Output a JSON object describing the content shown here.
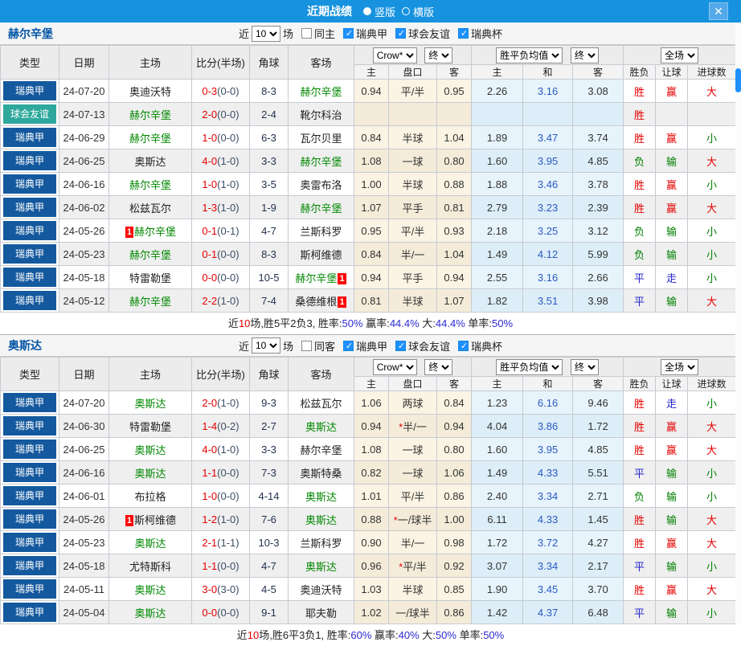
{
  "titlebar": {
    "title": "近期战绩",
    "vertical": "竖版",
    "horizontal": "横版",
    "close": "✕"
  },
  "badge_label": "1",
  "colors": {
    "accent_blue": "#1792DF",
    "league_blue": "#14599E",
    "friendly_teal": "#2EA89C",
    "win_red": "#E60000",
    "lose_green": "#008000",
    "draw_blue": "#2525CC",
    "self_team_green": "#008800",
    "score_red": "#E60000",
    "checkbox_blue": "#1E90FF"
  },
  "header": {
    "type": "类型",
    "date": "日期",
    "home": "主场",
    "score": "比分(半场)",
    "corner": "角球",
    "away": "客场",
    "h_home": "主",
    "h_pan": "盘口",
    "h_away": "客",
    "a_home": "主",
    "a_draw": "和",
    "a_away": "客",
    "wl": "胜负",
    "rq": "让球",
    "goals": "进球数",
    "crow": "Crow*",
    "end": "终",
    "avg": "胜平负均值",
    "full": "全场"
  },
  "tables": [
    {
      "team": "赫尔辛堡",
      "filter": {
        "near": "近",
        "count": "10",
        "games": "场",
        "same": "同主",
        "l1": "瑞典甲",
        "l2": "球会友谊",
        "l3": "瑞典杯"
      },
      "rows": [
        {
          "lg": "瑞典甲",
          "lt": "sw",
          "date": "24-07-20",
          "h": [
            "奥迪沃特",
            0,
            ""
          ],
          "s": "0-3",
          "hf": "(0-0)",
          "c": "8-3",
          "a": [
            "赫尔辛堡",
            1,
            ""
          ],
          "o": [
            "0.94",
            "平/半",
            "0.95"
          ],
          "star": 0,
          "avg": [
            "2.26",
            "3.16",
            "3.08"
          ],
          "r": [
            [
              "胜",
              "r"
            ],
            [
              "赢",
              "r"
            ],
            [
              "大",
              "r"
            ]
          ]
        },
        {
          "lg": "球会友谊",
          "lt": "fr",
          "date": "24-07-13",
          "h": [
            "赫尔辛堡",
            1,
            ""
          ],
          "s": "2-0",
          "hf": "(0-0)",
          "c": "2-4",
          "a": [
            "靴尔科治",
            0,
            ""
          ],
          "o": [
            "",
            "",
            ""
          ],
          "star": 0,
          "avg": [
            "",
            "",
            ""
          ],
          "r": [
            [
              "胜",
              "r"
            ],
            [
              "",
              ""
            ],
            [
              "",
              ""
            ]
          ]
        },
        {
          "lg": "瑞典甲",
          "lt": "sw",
          "date": "24-06-29",
          "h": [
            "赫尔辛堡",
            1,
            ""
          ],
          "s": "1-0",
          "hf": "(0-0)",
          "c": "6-3",
          "a": [
            "瓦尔贝里",
            0,
            ""
          ],
          "o": [
            "0.84",
            "半球",
            "1.04"
          ],
          "star": 0,
          "avg": [
            "1.89",
            "3.47",
            "3.74"
          ],
          "r": [
            [
              "胜",
              "r"
            ],
            [
              "赢",
              "r"
            ],
            [
              "小",
              "g"
            ]
          ]
        },
        {
          "lg": "瑞典甲",
          "lt": "sw",
          "date": "24-06-25",
          "h": [
            "奥斯达",
            0,
            ""
          ],
          "s": "4-0",
          "hf": "(1-0)",
          "c": "3-3",
          "a": [
            "赫尔辛堡",
            1,
            ""
          ],
          "o": [
            "1.08",
            "一球",
            "0.80"
          ],
          "star": 0,
          "avg": [
            "1.60",
            "3.95",
            "4.85"
          ],
          "r": [
            [
              "负",
              "g"
            ],
            [
              "输",
              "g"
            ],
            [
              "大",
              "r"
            ]
          ]
        },
        {
          "lg": "瑞典甲",
          "lt": "sw",
          "date": "24-06-16",
          "h": [
            "赫尔辛堡",
            1,
            ""
          ],
          "s": "1-0",
          "hf": "(1-0)",
          "c": "3-5",
          "a": [
            "奥雷布洛",
            0,
            ""
          ],
          "o": [
            "1.00",
            "半球",
            "0.88"
          ],
          "star": 0,
          "avg": [
            "1.88",
            "3.46",
            "3.78"
          ],
          "r": [
            [
              "胜",
              "r"
            ],
            [
              "赢",
              "r"
            ],
            [
              "小",
              "g"
            ]
          ]
        },
        {
          "lg": "瑞典甲",
          "lt": "sw",
          "date": "24-06-02",
          "h": [
            "松兹瓦尔",
            0,
            ""
          ],
          "s": "1-3",
          "hf": "(1-0)",
          "c": "1-9",
          "a": [
            "赫尔辛堡",
            1,
            ""
          ],
          "o": [
            "1.07",
            "平手",
            "0.81"
          ],
          "star": 0,
          "avg": [
            "2.79",
            "3.23",
            "2.39"
          ],
          "r": [
            [
              "胜",
              "r"
            ],
            [
              "赢",
              "r"
            ],
            [
              "大",
              "r"
            ]
          ]
        },
        {
          "lg": "瑞典甲",
          "lt": "sw",
          "date": "24-05-26",
          "h": [
            "赫尔辛堡",
            1,
            "pre"
          ],
          "s": "0-1",
          "hf": "(0-1)",
          "c": "4-7",
          "a": [
            "兰斯科罗",
            0,
            ""
          ],
          "o": [
            "0.95",
            "平/半",
            "0.93"
          ],
          "star": 0,
          "avg": [
            "2.18",
            "3.25",
            "3.12"
          ],
          "r": [
            [
              "负",
              "g"
            ],
            [
              "输",
              "g"
            ],
            [
              "小",
              "g"
            ]
          ]
        },
        {
          "lg": "瑞典甲",
          "lt": "sw",
          "date": "24-05-23",
          "h": [
            "赫尔辛堡",
            1,
            ""
          ],
          "s": "0-1",
          "hf": "(0-0)",
          "c": "8-3",
          "a": [
            "斯柯维德",
            0,
            ""
          ],
          "o": [
            "0.84",
            "半/一",
            "1.04"
          ],
          "star": 0,
          "avg": [
            "1.49",
            "4.12",
            "5.99"
          ],
          "r": [
            [
              "负",
              "g"
            ],
            [
              "输",
              "g"
            ],
            [
              "小",
              "g"
            ]
          ]
        },
        {
          "lg": "瑞典甲",
          "lt": "sw",
          "date": "24-05-18",
          "h": [
            "特雷勒堡",
            0,
            ""
          ],
          "s": "0-0",
          "hf": "(0-0)",
          "c": "10-5",
          "a": [
            "赫尔辛堡",
            1,
            "post"
          ],
          "o": [
            "0.94",
            "平手",
            "0.94"
          ],
          "star": 0,
          "avg": [
            "2.55",
            "3.16",
            "2.66"
          ],
          "r": [
            [
              "平",
              "b"
            ],
            [
              "走",
              "b"
            ],
            [
              "小",
              "g"
            ]
          ]
        },
        {
          "lg": "瑞典甲",
          "lt": "sw",
          "date": "24-05-12",
          "h": [
            "赫尔辛堡",
            1,
            ""
          ],
          "s": "2-2",
          "hf": "(1-0)",
          "c": "7-4",
          "a": [
            "桑德维根",
            0,
            "post"
          ],
          "o": [
            "0.81",
            "半球",
            "1.07"
          ],
          "star": 0,
          "avg": [
            "1.82",
            "3.51",
            "3.98"
          ],
          "r": [
            [
              "平",
              "b"
            ],
            [
              "输",
              "g"
            ],
            [
              "大",
              "r"
            ]
          ]
        }
      ],
      "summary": [
        [
          "近",
          "k"
        ],
        [
          "10",
          "r"
        ],
        [
          "场,胜5平2负3, 胜率:",
          "k"
        ],
        [
          "50%",
          "p"
        ],
        [
          " 赢率:",
          "k"
        ],
        [
          "44.4%",
          "p"
        ],
        [
          " 大:",
          "k"
        ],
        [
          "44.4%",
          "p"
        ],
        [
          " 单率:",
          "k"
        ],
        [
          "50%",
          "p"
        ]
      ]
    },
    {
      "team": "奥斯达",
      "filter": {
        "near": "近",
        "count": "10",
        "games": "场",
        "same": "同客",
        "l1": "瑞典甲",
        "l2": "球会友谊",
        "l3": "瑞典杯"
      },
      "rows": [
        {
          "lg": "瑞典甲",
          "lt": "sw",
          "date": "24-07-20",
          "h": [
            "奥斯达",
            1,
            ""
          ],
          "s": "2-0",
          "hf": "(1-0)",
          "c": "9-3",
          "a": [
            "松兹瓦尔",
            0,
            ""
          ],
          "o": [
            "1.06",
            "两球",
            "0.84"
          ],
          "star": 0,
          "avg": [
            "1.23",
            "6.16",
            "9.46"
          ],
          "r": [
            [
              "胜",
              "r"
            ],
            [
              "走",
              "b"
            ],
            [
              "小",
              "g"
            ]
          ]
        },
        {
          "lg": "瑞典甲",
          "lt": "sw",
          "date": "24-06-30",
          "h": [
            "特雷勒堡",
            0,
            ""
          ],
          "s": "1-4",
          "hf": "(0-2)",
          "c": "2-7",
          "a": [
            "奥斯达",
            1,
            ""
          ],
          "o": [
            "0.94",
            "半/一",
            "0.94"
          ],
          "star": 1,
          "avg": [
            "4.04",
            "3.86",
            "1.72"
          ],
          "r": [
            [
              "胜",
              "r"
            ],
            [
              "赢",
              "r"
            ],
            [
              "大",
              "r"
            ]
          ]
        },
        {
          "lg": "瑞典甲",
          "lt": "sw",
          "date": "24-06-25",
          "h": [
            "奥斯达",
            1,
            ""
          ],
          "s": "4-0",
          "hf": "(1-0)",
          "c": "3-3",
          "a": [
            "赫尔辛堡",
            0,
            ""
          ],
          "o": [
            "1.08",
            "一球",
            "0.80"
          ],
          "star": 0,
          "avg": [
            "1.60",
            "3.95",
            "4.85"
          ],
          "r": [
            [
              "胜",
              "r"
            ],
            [
              "赢",
              "r"
            ],
            [
              "大",
              "r"
            ]
          ]
        },
        {
          "lg": "瑞典甲",
          "lt": "sw",
          "date": "24-06-16",
          "h": [
            "奥斯达",
            1,
            ""
          ],
          "s": "1-1",
          "hf": "(0-0)",
          "c": "7-3",
          "a": [
            "奥斯特桑",
            0,
            ""
          ],
          "o": [
            "0.82",
            "一球",
            "1.06"
          ],
          "star": 0,
          "avg": [
            "1.49",
            "4.33",
            "5.51"
          ],
          "r": [
            [
              "平",
              "b"
            ],
            [
              "输",
              "g"
            ],
            [
              "小",
              "g"
            ]
          ]
        },
        {
          "lg": "瑞典甲",
          "lt": "sw",
          "date": "24-06-01",
          "h": [
            "布拉格",
            0,
            ""
          ],
          "s": "1-0",
          "hf": "(0-0)",
          "c": "4-14",
          "a": [
            "奥斯达",
            1,
            ""
          ],
          "o": [
            "1.01",
            "平/半",
            "0.86"
          ],
          "star": 0,
          "avg": [
            "2.40",
            "3.34",
            "2.71"
          ],
          "r": [
            [
              "负",
              "g"
            ],
            [
              "输",
              "g"
            ],
            [
              "小",
              "g"
            ]
          ]
        },
        {
          "lg": "瑞典甲",
          "lt": "sw",
          "date": "24-05-26",
          "h": [
            "斯柯维德",
            0,
            "pre"
          ],
          "s": "1-2",
          "hf": "(1-0)",
          "c": "7-6",
          "a": [
            "奥斯达",
            1,
            ""
          ],
          "o": [
            "0.88",
            "一/球半",
            "1.00"
          ],
          "star": 1,
          "avg": [
            "6.11",
            "4.33",
            "1.45"
          ],
          "r": [
            [
              "胜",
              "r"
            ],
            [
              "输",
              "g"
            ],
            [
              "大",
              "r"
            ]
          ]
        },
        {
          "lg": "瑞典甲",
          "lt": "sw",
          "date": "24-05-23",
          "h": [
            "奥斯达",
            1,
            ""
          ],
          "s": "2-1",
          "hf": "(1-1)",
          "c": "10-3",
          "a": [
            "兰斯科罗",
            0,
            ""
          ],
          "o": [
            "0.90",
            "半/一",
            "0.98"
          ],
          "star": 0,
          "avg": [
            "1.72",
            "3.72",
            "4.27"
          ],
          "r": [
            [
              "胜",
              "r"
            ],
            [
              "赢",
              "r"
            ],
            [
              "大",
              "r"
            ]
          ]
        },
        {
          "lg": "瑞典甲",
          "lt": "sw",
          "date": "24-05-18",
          "h": [
            "尤特斯科",
            0,
            ""
          ],
          "s": "1-1",
          "hf": "(0-0)",
          "c": "4-7",
          "a": [
            "奥斯达",
            1,
            ""
          ],
          "o": [
            "0.96",
            "平/半",
            "0.92"
          ],
          "star": 1,
          "avg": [
            "3.07",
            "3.34",
            "2.17"
          ],
          "r": [
            [
              "平",
              "b"
            ],
            [
              "输",
              "g"
            ],
            [
              "小",
              "g"
            ]
          ]
        },
        {
          "lg": "瑞典甲",
          "lt": "sw",
          "date": "24-05-11",
          "h": [
            "奥斯达",
            1,
            ""
          ],
          "s": "3-0",
          "hf": "(3-0)",
          "c": "4-5",
          "a": [
            "奥迪沃特",
            0,
            ""
          ],
          "o": [
            "1.03",
            "半球",
            "0.85"
          ],
          "star": 0,
          "avg": [
            "1.90",
            "3.45",
            "3.70"
          ],
          "r": [
            [
              "胜",
              "r"
            ],
            [
              "赢",
              "r"
            ],
            [
              "大",
              "r"
            ]
          ]
        },
        {
          "lg": "瑞典甲",
          "lt": "sw",
          "date": "24-05-04",
          "h": [
            "奥斯达",
            1,
            ""
          ],
          "s": "0-0",
          "hf": "(0-0)",
          "c": "9-1",
          "a": [
            "耶夫勒",
            0,
            ""
          ],
          "o": [
            "1.02",
            "一/球半",
            "0.86"
          ],
          "star": 0,
          "avg": [
            "1.42",
            "4.37",
            "6.48"
          ],
          "r": [
            [
              "平",
              "b"
            ],
            [
              "输",
              "g"
            ],
            [
              "小",
              "g"
            ]
          ]
        }
      ],
      "summary": [
        [
          "近",
          "k"
        ],
        [
          "10",
          "r"
        ],
        [
          "场,胜6平3负1, 胜率:",
          "k"
        ],
        [
          "60%",
          "p"
        ],
        [
          " 赢率:",
          "k"
        ],
        [
          "40%",
          "p"
        ],
        [
          " 大:",
          "k"
        ],
        [
          "50%",
          "p"
        ],
        [
          " 单率:",
          "k"
        ],
        [
          "50%",
          "p"
        ]
      ]
    }
  ]
}
